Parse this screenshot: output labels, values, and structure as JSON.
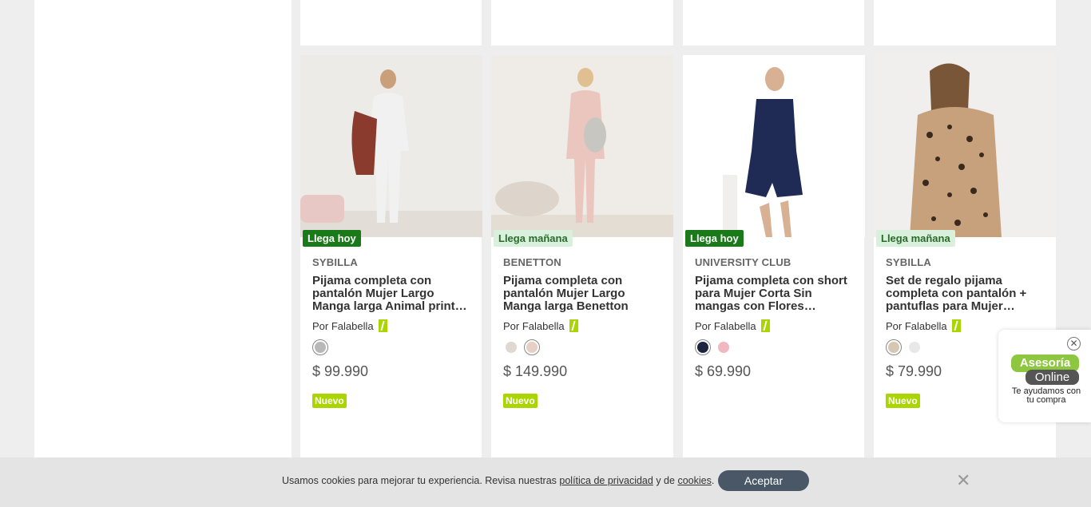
{
  "products": [
    {
      "arrival": "Llega hoy",
      "arrival_kind": "today",
      "brand": "SYBILLA",
      "title": "Pijama completa con pantalón Mujer Largo Manga larga Animal print…",
      "seller": "Por Falabella",
      "price": "$ 99.990",
      "badge": "Nuevo",
      "swatches": [
        {
          "color": "#b8b8b8",
          "selected": true
        }
      ]
    },
    {
      "arrival": "Llega mañana",
      "arrival_kind": "tomorrow",
      "brand": "BENETTON",
      "title": "Pijama completa con pantalón Mujer Largo Manga larga Benetton",
      "seller": "Por Falabella",
      "price": "$ 149.990",
      "badge": "Nuevo",
      "swatches": [
        {
          "color": "#e0d8d0",
          "selected": false
        },
        {
          "color": "#e6cfc3",
          "selected": true
        }
      ]
    },
    {
      "arrival": "Llega hoy",
      "arrival_kind": "today",
      "brand": "UNIVERSITY CLUB",
      "title": "Pijama completa con short para Mujer Corta Sin mangas con Flores…",
      "seller": "Por Falabella",
      "price": "$ 69.990",
      "badge": "",
      "swatches": [
        {
          "color": "#1c2440",
          "selected": true
        },
        {
          "color": "#f0b8c0",
          "selected": false
        }
      ]
    },
    {
      "arrival": "Llega mañana",
      "arrival_kind": "tomorrow",
      "brand": "SYBILLA",
      "title": "Set de regalo pijama completa con pantalón + pantuflas para Mujer…",
      "seller": "Por Falabella",
      "price": "$ 79.990",
      "badge": "Nuevo",
      "swatches": [
        {
          "color": "#d6c7b2",
          "selected": true
        },
        {
          "color": "#e8e8e8",
          "selected": false
        }
      ]
    }
  ],
  "chat": {
    "line1": "Asesoría",
    "line2": "Online",
    "tagline": "Te ayudamos con tu compra",
    "close_icon": "close-circle-icon"
  },
  "cookie": {
    "text_before": "Usamos cookies para mejorar tu experiencia. Revisa nuestras",
    "privacy_link": "política de privacidad",
    "text_mid": "y de",
    "cookies_link": "cookies",
    "text_end": ".",
    "accept": "Aceptar",
    "close_icon": "close-icon"
  },
  "colors": {
    "today_badge": "#1a7a1a",
    "tomorrow_badge": "#d9f0dd",
    "new_badge": "#aad500",
    "accept_button": "#4a5767"
  }
}
